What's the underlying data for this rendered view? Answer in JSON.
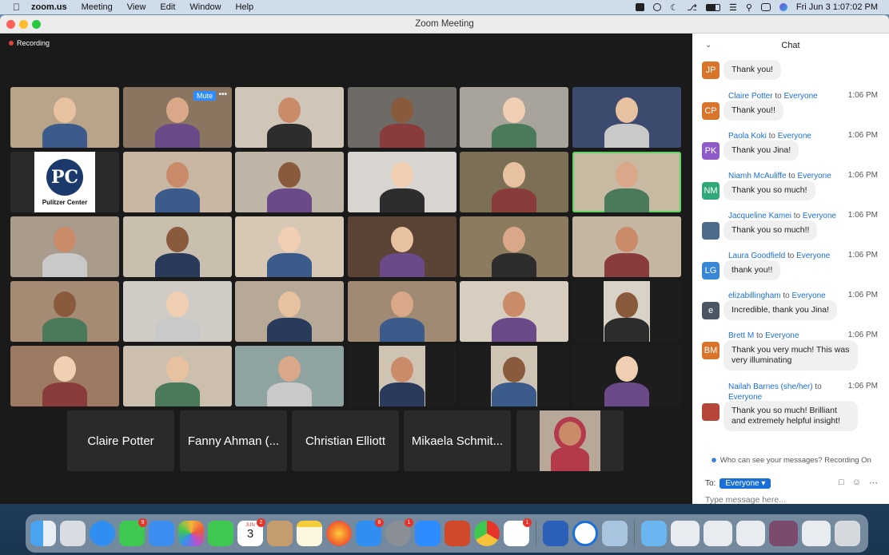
{
  "menubar": {
    "app_name": "zoom.us",
    "items": [
      "Meeting",
      "View",
      "Edit",
      "Window",
      "Help"
    ],
    "clock": "Fri Jun 3  1:07:02 PM"
  },
  "window": {
    "title": "Zoom Meeting"
  },
  "meeting": {
    "recording_label": "Recording",
    "mute_label": "Mute",
    "more_label": "•••",
    "pulitzer_text": "Pulitzer Center",
    "pulitzer_initials": "PC",
    "name_tiles": [
      "Claire Potter",
      "Fanny Ahman (...",
      "Christian Elliott",
      "Mikaela Schmit..."
    ]
  },
  "chat": {
    "title": "Chat",
    "messages": [
      {
        "avatar": "JP",
        "avatar_color": "#d9742b",
        "sender": "",
        "to": "",
        "time": "",
        "text": "Thank you!"
      },
      {
        "avatar": "CP",
        "avatar_color": "#d9742b",
        "sender": "Claire Potter",
        "to": "to",
        "recipient": "Everyone",
        "time": "1:06 PM",
        "text": "Thank you!!"
      },
      {
        "avatar": "PK",
        "avatar_color": "#8e5bc9",
        "sender": "Paola Koki",
        "to": "to",
        "recipient": "Everyone",
        "time": "1:06 PM",
        "text": "Thank you Jina!"
      },
      {
        "avatar": "NM",
        "avatar_color": "#2fa87a",
        "sender": "Niamh McAuliffe",
        "to": "to",
        "recipient": "Everyone",
        "time": "1:06 PM",
        "text": "Thank you so much!"
      },
      {
        "avatar": "",
        "avatar_color": "#4d6b8a",
        "sender": "Jacqueline Kamei",
        "to": "to",
        "recipient": "Everyone",
        "time": "1:06 PM",
        "text": "Thank you so much!!"
      },
      {
        "avatar": "LG",
        "avatar_color": "#3a86d6",
        "sender": "Laura Goodfield",
        "to": "to",
        "recipient": "Everyone",
        "time": "1:06 PM",
        "text": "thank you!!"
      },
      {
        "avatar": "e",
        "avatar_color": "#4a5663",
        "sender": "elizabillingham",
        "to": "to",
        "recipient": "Everyone",
        "time": "1:06 PM",
        "text": "Incredible, thank you Jina!"
      },
      {
        "avatar": "BM",
        "avatar_color": "#d9742b",
        "sender": "Brett M",
        "to": "to",
        "recipient": "Everyone",
        "time": "1:06 PM",
        "text": "Thank you very much! This was very illuminating"
      },
      {
        "avatar": "",
        "avatar_color": "#b8453a",
        "sender": "Nailah Barnes (she/her)",
        "to": "to",
        "recipient": "Everyone",
        "time": "1:06 PM",
        "text": "Thank you so much! Brilliant and extremely helpful insight!"
      }
    ],
    "visibility_note": "Who can see your messages? Recording On",
    "to_label": "To:",
    "to_value": "Everyone ▾",
    "input_placeholder": "Type message here..."
  },
  "dock": {
    "calendar_month": "JUN",
    "calendar_day": "3",
    "badges": {
      "messages": "9",
      "calendar": "2",
      "appstore": "8",
      "settings": "1",
      "slack": "1"
    }
  }
}
